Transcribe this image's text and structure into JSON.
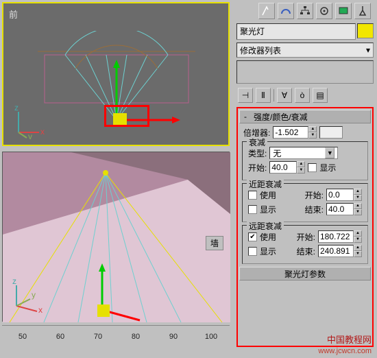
{
  "viewport_top": {
    "label": "前"
  },
  "viewport_bot": {
    "wall_label": "墙"
  },
  "ruler": {
    "ticks": [
      50,
      60,
      70,
      80,
      90,
      100
    ]
  },
  "toolbar_top": {
    "icons": [
      "arrow-icon",
      "arc-icon",
      "hierarchy-icon",
      "motion-icon",
      "display-icon",
      "utilities-icon"
    ]
  },
  "object_name": "聚光灯",
  "modifier_list_label": "修改器列表",
  "rollup_intensity": {
    "title": "强度/颜色/衰减",
    "multiplier_label": "倍增器:",
    "multiplier_value": "-1.502",
    "decay": {
      "title": "衰减",
      "type_label": "类型:",
      "type_value": "无",
      "start_label": "开始:",
      "start_value": "40.0",
      "show_label": "显示"
    },
    "near": {
      "title": "近距衰减",
      "use_label": "使用",
      "show_label": "显示",
      "start_label": "开始:",
      "start_value": "0.0",
      "end_label": "结束:",
      "end_value": "40.0",
      "use_checked": false,
      "show_checked": false
    },
    "far": {
      "title": "远距衰减",
      "use_label": "使用",
      "show_label": "显示",
      "start_label": "开始:",
      "start_value": "180.722",
      "end_label": "结束:",
      "end_value": "240.891",
      "use_checked": true,
      "show_checked": false
    }
  },
  "rollup_spot": {
    "title": "聚光灯参数"
  },
  "watermark": {
    "line1": "中国教程网",
    "line2": "www.jcwcn.com"
  }
}
